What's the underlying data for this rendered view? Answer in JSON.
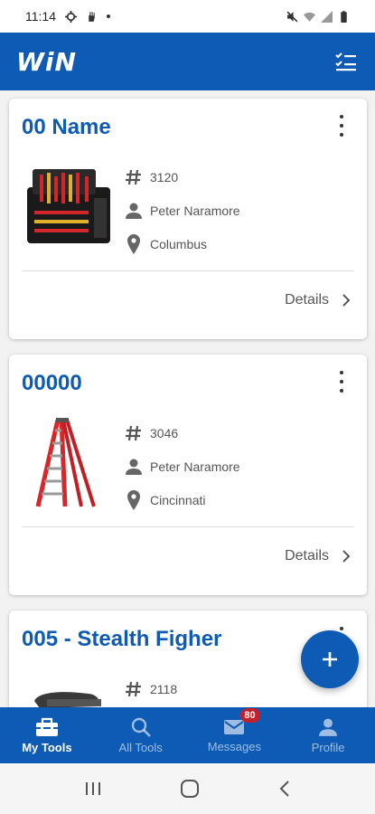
{
  "status_bar": {
    "time": "11:14"
  },
  "app": {
    "logo_text": "WiN"
  },
  "cards": [
    {
      "title": "00 Name",
      "number": "3120",
      "person": "Peter Naramore",
      "location": "Columbus",
      "details_label": "Details",
      "image": "tool-bag"
    },
    {
      "title": "00000",
      "number": "3046",
      "person": "Peter Naramore",
      "location": "Cincinnati",
      "details_label": "Details",
      "image": "ladder"
    },
    {
      "title": "005 -  Stealth Figher",
      "number": "2118",
      "image": "power-tool"
    }
  ],
  "bottom_nav": [
    {
      "label": "My Tools",
      "icon": "toolbox-icon",
      "active": true
    },
    {
      "label": "All Tools",
      "icon": "search-icon",
      "active": false
    },
    {
      "label": "Messages",
      "icon": "mail-icon",
      "active": false,
      "badge": "80"
    },
    {
      "label": "Profile",
      "icon": "person-icon",
      "active": false
    }
  ],
  "colors": {
    "primary": "#0d5bb5",
    "badge": "#c3202a"
  }
}
